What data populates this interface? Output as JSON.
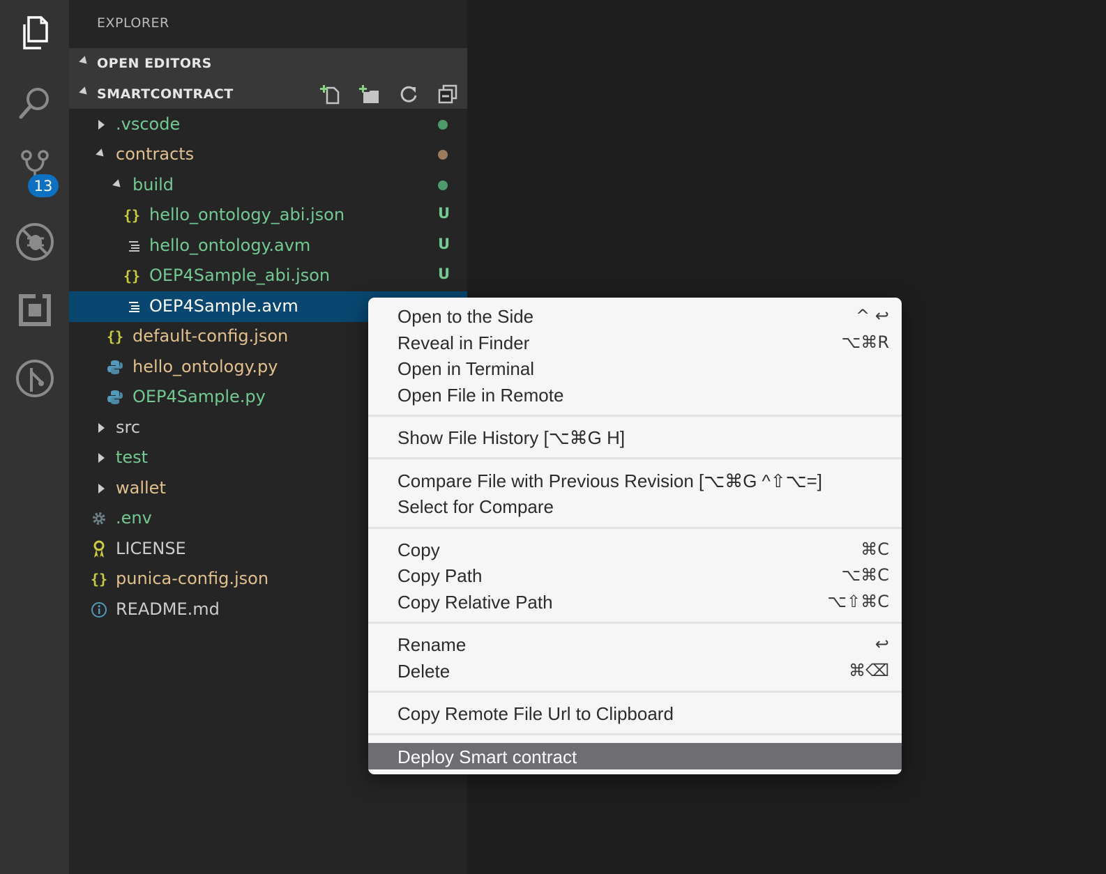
{
  "activity_bar": {
    "items": [
      "explorer-icon",
      "search-icon",
      "source-control-icon",
      "debug-icon",
      "extensions-icon",
      "punica-icon"
    ],
    "scm_badge": "13"
  },
  "sidebar": {
    "title": "EXPLORER",
    "sections": {
      "open_editors": "OPEN EDITORS",
      "workspace": "SMARTCONTRACT"
    },
    "tree": [
      {
        "label": ".vscode",
        "color": "#73c991",
        "status": "dot",
        "status_color": "#4e9a6a"
      },
      {
        "label": "contracts",
        "color": "#e2c08d",
        "status": "dot",
        "status_color": "#9b7b5b"
      },
      {
        "label": "build",
        "color": "#73c991",
        "status": "dot",
        "status_color": "#4e9a6a"
      },
      {
        "label": "hello_ontology_abi.json",
        "color": "#73c991",
        "icon": "json-icon",
        "status": "U"
      },
      {
        "label": "hello_ontology.avm",
        "color": "#73c991",
        "icon": "text-file-icon",
        "status": "U"
      },
      {
        "label": "OEP4Sample_abi.json",
        "color": "#73c991",
        "icon": "json-icon",
        "status": "U"
      },
      {
        "label": "OEP4Sample.avm",
        "color": "#ffffff",
        "icon": "text-file-icon"
      },
      {
        "label": "default-config.json",
        "color": "#e2c08d",
        "icon": "json-icon"
      },
      {
        "label": "hello_ontology.py",
        "color": "#e2c08d",
        "icon": "python-icon"
      },
      {
        "label": "OEP4Sample.py",
        "color": "#73c991",
        "icon": "python-icon"
      },
      {
        "label": "src",
        "color": "#cccccc"
      },
      {
        "label": "test",
        "color": "#73c991"
      },
      {
        "label": "wallet",
        "color": "#e2c08d"
      },
      {
        "label": ".env",
        "color": "#73c991",
        "icon": "gear-icon"
      },
      {
        "label": "LICENSE",
        "color": "#cccccc",
        "icon": "license-icon"
      },
      {
        "label": "punica-config.json",
        "color": "#e2c08d",
        "icon": "json-icon"
      },
      {
        "label": "README.md",
        "color": "#cccccc",
        "icon": "info-icon"
      }
    ]
  },
  "context_menu": {
    "items": [
      {
        "label": "Open to the Side",
        "shortcut": "^ ↩"
      },
      {
        "label": "Reveal in Finder",
        "shortcut": "⌥⌘R"
      },
      {
        "label": "Open in Terminal",
        "shortcut": ""
      },
      {
        "label": "Open File in Remote",
        "shortcut": ""
      },
      {
        "label": "Show File History [⌥⌘G H]",
        "shortcut": ""
      },
      {
        "label": "Compare File with Previous Revision [⌥⌘G ^⇧⌥=]",
        "shortcut": ""
      },
      {
        "label": "Select for Compare",
        "shortcut": ""
      },
      {
        "label": "Copy",
        "shortcut": "⌘C"
      },
      {
        "label": "Copy Path",
        "shortcut": "⌥⌘C"
      },
      {
        "label": "Copy Relative Path",
        "shortcut": "⌥⇧⌘C"
      },
      {
        "label": "Rename",
        "shortcut": "↩"
      },
      {
        "label": "Delete",
        "shortcut": "⌘⌫"
      },
      {
        "label": "Copy Remote File Url to Clipboard",
        "shortcut": ""
      },
      {
        "label": "Deploy Smart contract",
        "shortcut": ""
      }
    ]
  }
}
